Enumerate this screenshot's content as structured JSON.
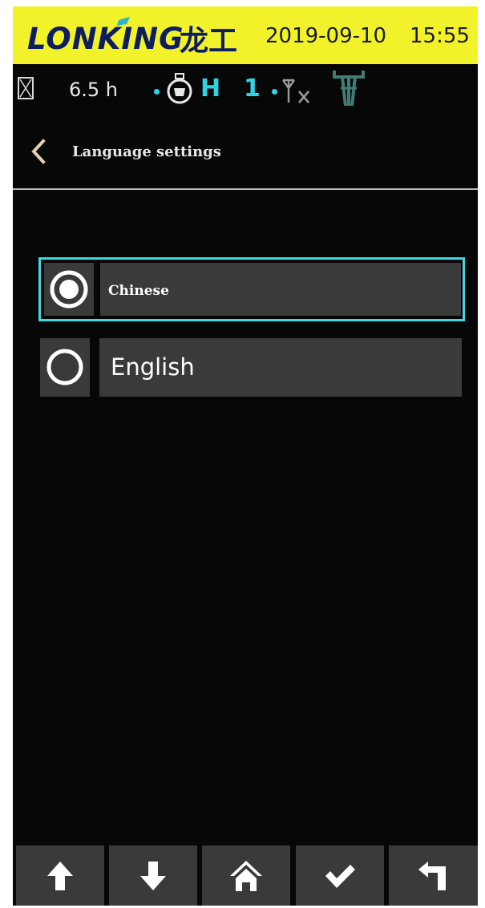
{
  "brand": {
    "logo_text": "LONKING",
    "logo_cn": "龙工",
    "date": "2019-09-10",
    "time": "15:55",
    "bar_color": "#f2f22b"
  },
  "status": {
    "icons": [
      "hourglass-icon",
      "engine-icon",
      "antenna-off-icon",
      "tower-icon"
    ],
    "hours": "6.5 h",
    "gear_mode": "H",
    "gear_number": "1",
    "accent_color": "#2fd3e6"
  },
  "header": {
    "back_icon": "chevron-left-icon",
    "title": "Language settings"
  },
  "languages": {
    "options": [
      {
        "label": "Chinese",
        "selected": true
      },
      {
        "label": "English",
        "selected": false
      }
    ],
    "selection_color": "#3fd7e0"
  },
  "nav": {
    "buttons": [
      "arrow-up-icon",
      "arrow-down-icon",
      "home-icon",
      "check-icon",
      "return-icon"
    ]
  }
}
